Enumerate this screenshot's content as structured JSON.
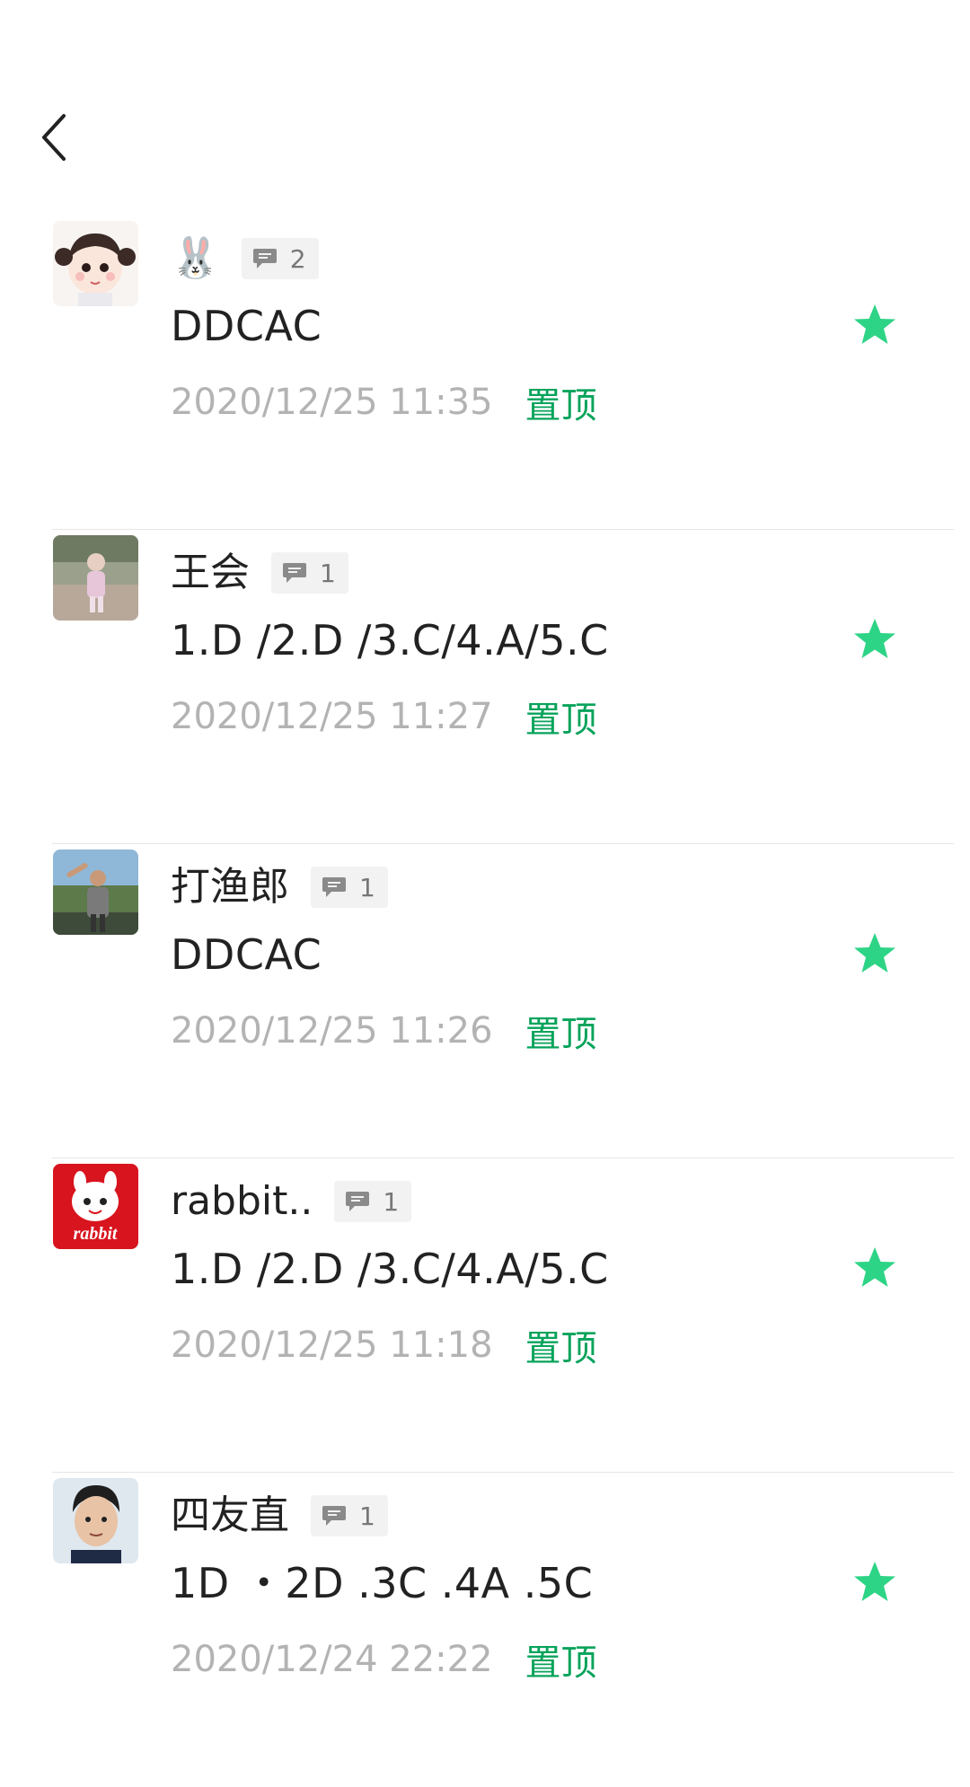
{
  "colors": {
    "accent_green": "#07a35b",
    "star_green": "#2ed486",
    "time_gray": "#b3b3b3",
    "divider": "#e6e6e6"
  },
  "header": {
    "back_icon": "chevron-left-icon"
  },
  "items": [
    {
      "name": "🐰",
      "comment_count": "2",
      "content": "DDCAC",
      "time": "2020/12/25 11:35",
      "pin_label": "置顶",
      "starred": true
    },
    {
      "name": "王会",
      "comment_count": "1",
      "content": "1.D /2.D /3.C/4.A/5.C",
      "time": "2020/12/25 11:27",
      "pin_label": "置顶",
      "starred": true
    },
    {
      "name": "打渔郎",
      "comment_count": "1",
      "content": "DDCAC",
      "time": "2020/12/25 11:26",
      "pin_label": "置顶",
      "starred": true
    },
    {
      "name": "rabbit..",
      "comment_count": "1",
      "content": "1.D /2.D /3.C/4.A/5.C",
      "time": "2020/12/25 11:18",
      "pin_label": "置顶",
      "starred": true
    },
    {
      "name": "四友直",
      "comment_count": "1",
      "content": "1D ・2D .3C .4A .5C",
      "time": "2020/12/24 22:22",
      "pin_label": "置顶",
      "starred": true
    }
  ]
}
